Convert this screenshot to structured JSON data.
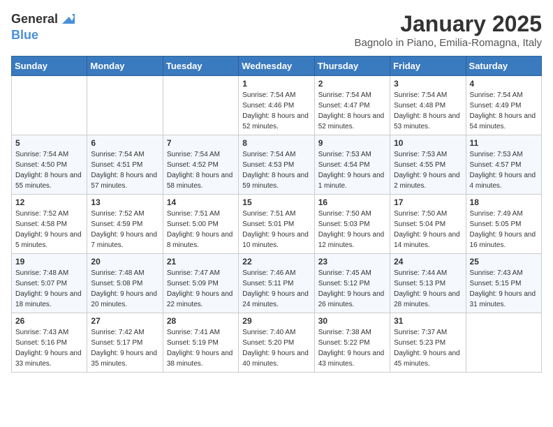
{
  "logo": {
    "line1": "General",
    "line2": "Blue"
  },
  "title": "January 2025",
  "subtitle": "Bagnolo in Piano, Emilia-Romagna, Italy",
  "weekdays": [
    "Sunday",
    "Monday",
    "Tuesday",
    "Wednesday",
    "Thursday",
    "Friday",
    "Saturday"
  ],
  "weeks": [
    [
      {
        "day": "",
        "info": ""
      },
      {
        "day": "",
        "info": ""
      },
      {
        "day": "",
        "info": ""
      },
      {
        "day": "1",
        "info": "Sunrise: 7:54 AM\nSunset: 4:46 PM\nDaylight: 8 hours and 52 minutes."
      },
      {
        "day": "2",
        "info": "Sunrise: 7:54 AM\nSunset: 4:47 PM\nDaylight: 8 hours and 52 minutes."
      },
      {
        "day": "3",
        "info": "Sunrise: 7:54 AM\nSunset: 4:48 PM\nDaylight: 8 hours and 53 minutes."
      },
      {
        "day": "4",
        "info": "Sunrise: 7:54 AM\nSunset: 4:49 PM\nDaylight: 8 hours and 54 minutes."
      }
    ],
    [
      {
        "day": "5",
        "info": "Sunrise: 7:54 AM\nSunset: 4:50 PM\nDaylight: 8 hours and 55 minutes."
      },
      {
        "day": "6",
        "info": "Sunrise: 7:54 AM\nSunset: 4:51 PM\nDaylight: 8 hours and 57 minutes."
      },
      {
        "day": "7",
        "info": "Sunrise: 7:54 AM\nSunset: 4:52 PM\nDaylight: 8 hours and 58 minutes."
      },
      {
        "day": "8",
        "info": "Sunrise: 7:54 AM\nSunset: 4:53 PM\nDaylight: 8 hours and 59 minutes."
      },
      {
        "day": "9",
        "info": "Sunrise: 7:53 AM\nSunset: 4:54 PM\nDaylight: 9 hours and 1 minute."
      },
      {
        "day": "10",
        "info": "Sunrise: 7:53 AM\nSunset: 4:55 PM\nDaylight: 9 hours and 2 minutes."
      },
      {
        "day": "11",
        "info": "Sunrise: 7:53 AM\nSunset: 4:57 PM\nDaylight: 9 hours and 4 minutes."
      }
    ],
    [
      {
        "day": "12",
        "info": "Sunrise: 7:52 AM\nSunset: 4:58 PM\nDaylight: 9 hours and 5 minutes."
      },
      {
        "day": "13",
        "info": "Sunrise: 7:52 AM\nSunset: 4:59 PM\nDaylight: 9 hours and 7 minutes."
      },
      {
        "day": "14",
        "info": "Sunrise: 7:51 AM\nSunset: 5:00 PM\nDaylight: 9 hours and 8 minutes."
      },
      {
        "day": "15",
        "info": "Sunrise: 7:51 AM\nSunset: 5:01 PM\nDaylight: 9 hours and 10 minutes."
      },
      {
        "day": "16",
        "info": "Sunrise: 7:50 AM\nSunset: 5:03 PM\nDaylight: 9 hours and 12 minutes."
      },
      {
        "day": "17",
        "info": "Sunrise: 7:50 AM\nSunset: 5:04 PM\nDaylight: 9 hours and 14 minutes."
      },
      {
        "day": "18",
        "info": "Sunrise: 7:49 AM\nSunset: 5:05 PM\nDaylight: 9 hours and 16 minutes."
      }
    ],
    [
      {
        "day": "19",
        "info": "Sunrise: 7:48 AM\nSunset: 5:07 PM\nDaylight: 9 hours and 18 minutes."
      },
      {
        "day": "20",
        "info": "Sunrise: 7:48 AM\nSunset: 5:08 PM\nDaylight: 9 hours and 20 minutes."
      },
      {
        "day": "21",
        "info": "Sunrise: 7:47 AM\nSunset: 5:09 PM\nDaylight: 9 hours and 22 minutes."
      },
      {
        "day": "22",
        "info": "Sunrise: 7:46 AM\nSunset: 5:11 PM\nDaylight: 9 hours and 24 minutes."
      },
      {
        "day": "23",
        "info": "Sunrise: 7:45 AM\nSunset: 5:12 PM\nDaylight: 9 hours and 26 minutes."
      },
      {
        "day": "24",
        "info": "Sunrise: 7:44 AM\nSunset: 5:13 PM\nDaylight: 9 hours and 28 minutes."
      },
      {
        "day": "25",
        "info": "Sunrise: 7:43 AM\nSunset: 5:15 PM\nDaylight: 9 hours and 31 minutes."
      }
    ],
    [
      {
        "day": "26",
        "info": "Sunrise: 7:43 AM\nSunset: 5:16 PM\nDaylight: 9 hours and 33 minutes."
      },
      {
        "day": "27",
        "info": "Sunrise: 7:42 AM\nSunset: 5:17 PM\nDaylight: 9 hours and 35 minutes."
      },
      {
        "day": "28",
        "info": "Sunrise: 7:41 AM\nSunset: 5:19 PM\nDaylight: 9 hours and 38 minutes."
      },
      {
        "day": "29",
        "info": "Sunrise: 7:40 AM\nSunset: 5:20 PM\nDaylight: 9 hours and 40 minutes."
      },
      {
        "day": "30",
        "info": "Sunrise: 7:38 AM\nSunset: 5:22 PM\nDaylight: 9 hours and 43 minutes."
      },
      {
        "day": "31",
        "info": "Sunrise: 7:37 AM\nSunset: 5:23 PM\nDaylight: 9 hours and 45 minutes."
      },
      {
        "day": "",
        "info": ""
      }
    ]
  ]
}
